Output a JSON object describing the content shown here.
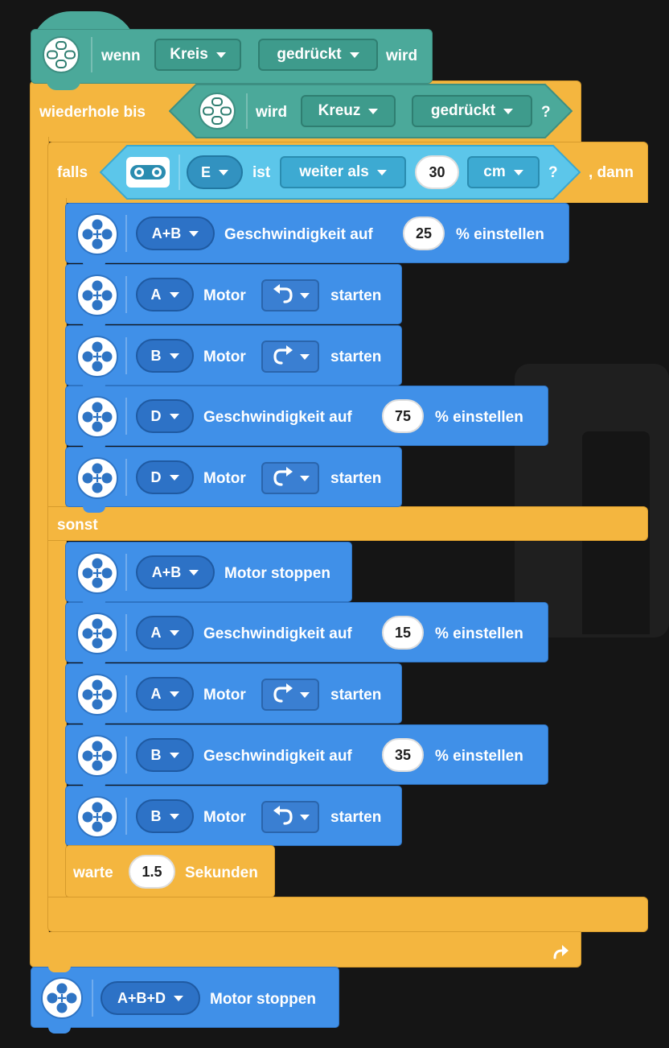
{
  "hat": {
    "when": "wenn",
    "button": "Kreis",
    "state": "gedrückt",
    "wird": "wird"
  },
  "repeat": {
    "label": "wiederhole bis",
    "wird": "wird",
    "button": "Kreuz",
    "state": "gedrückt",
    "q": "?"
  },
  "iff": {
    "label": "falls",
    "port": "E",
    "ist": "ist",
    "comparison": "weiter als",
    "value": "30",
    "unit": "cm",
    "q": "?",
    "then": ", dann"
  },
  "then_blocks": [
    {
      "port": "A+B",
      "text1": "Geschwindigkeit auf",
      "value": "25",
      "text2": "% einstellen"
    },
    {
      "port": "A",
      "text1": "Motor",
      "dir": "ccw",
      "text2": "starten"
    },
    {
      "port": "B",
      "text1": "Motor",
      "dir": "cw",
      "text2": "starten"
    },
    {
      "port": "D",
      "text1": "Geschwindigkeit auf",
      "value": "75",
      "text2": "% einstellen"
    },
    {
      "port": "D",
      "text1": "Motor",
      "dir": "cw",
      "text2": "starten"
    }
  ],
  "else_label": "sonst",
  "else_blocks": [
    {
      "port": "A+B",
      "text1": "Motor stoppen"
    },
    {
      "port": "A",
      "text1": "Geschwindigkeit auf",
      "value": "15",
      "text2": "% einstellen"
    },
    {
      "port": "A",
      "text1": "Motor",
      "dir": "cw",
      "text2": "starten"
    },
    {
      "port": "B",
      "text1": "Geschwindigkeit auf",
      "value": "35",
      "text2": "% einstellen"
    },
    {
      "port": "B",
      "text1": "Motor",
      "dir": "ccw",
      "text2": "starten"
    }
  ],
  "wait": {
    "label": "warte",
    "value": "1.5",
    "unit": "Sekunden"
  },
  "final": {
    "port": "A+B+D",
    "text": "Motor stoppen"
  },
  "colors": {
    "events": "#4ba99a",
    "control": "#f4b63f",
    "motor": "#4090e8",
    "sensor": "#5cc6ea",
    "background": "#151515"
  },
  "icons": {
    "hub": "hub-buttons-icon",
    "motor": "motor-icon",
    "sensor": "distance-sensor-icon",
    "loop": "loop-arrow-icon"
  }
}
